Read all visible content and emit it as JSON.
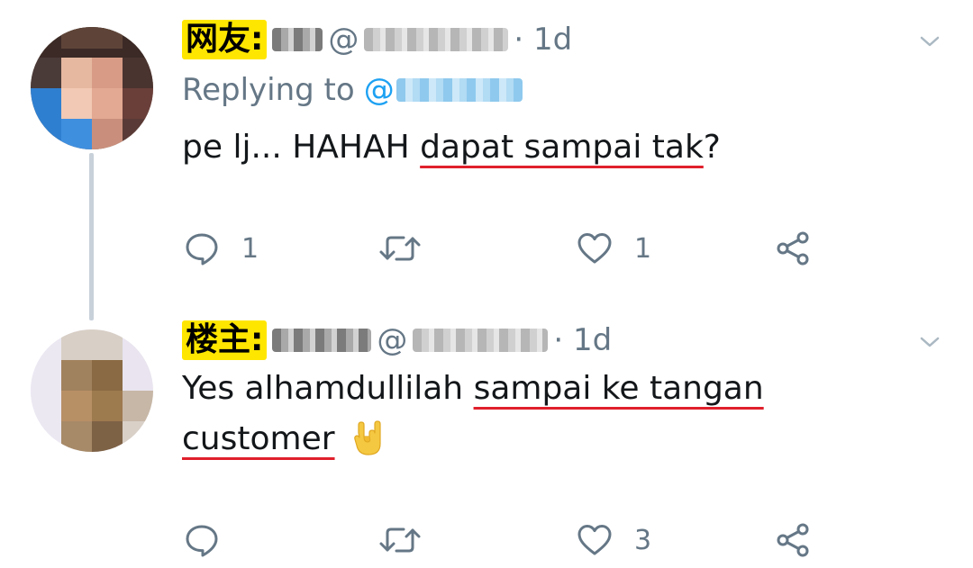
{
  "replies": [
    {
      "label": "网友:",
      "at_symbol": "@",
      "time": "· 1d",
      "replying_prefix": "Replying to",
      "replying_at": "@",
      "text_plain": "pe lj... HAHAH ",
      "text_underlined": "dapat sampai tak",
      "text_suffix": "?",
      "reply_count": "1",
      "retweet_count": "",
      "like_count": "1"
    },
    {
      "label": "楼主:",
      "at_symbol": "@",
      "time": "· 1d",
      "line1_plain": "Yes alhamdullilah ",
      "line1_underlined": "sampai ke tangan",
      "line2_underlined": "customer",
      "emoji": "rock-on-hand",
      "reply_count": "",
      "retweet_count": "",
      "like_count": "3"
    }
  ],
  "colors": {
    "label_bg": "#ffe600",
    "secondary_text": "#657786",
    "mention": "#1da1f2",
    "underline": "#e0202c",
    "thread_line": "#c8d1d9"
  }
}
